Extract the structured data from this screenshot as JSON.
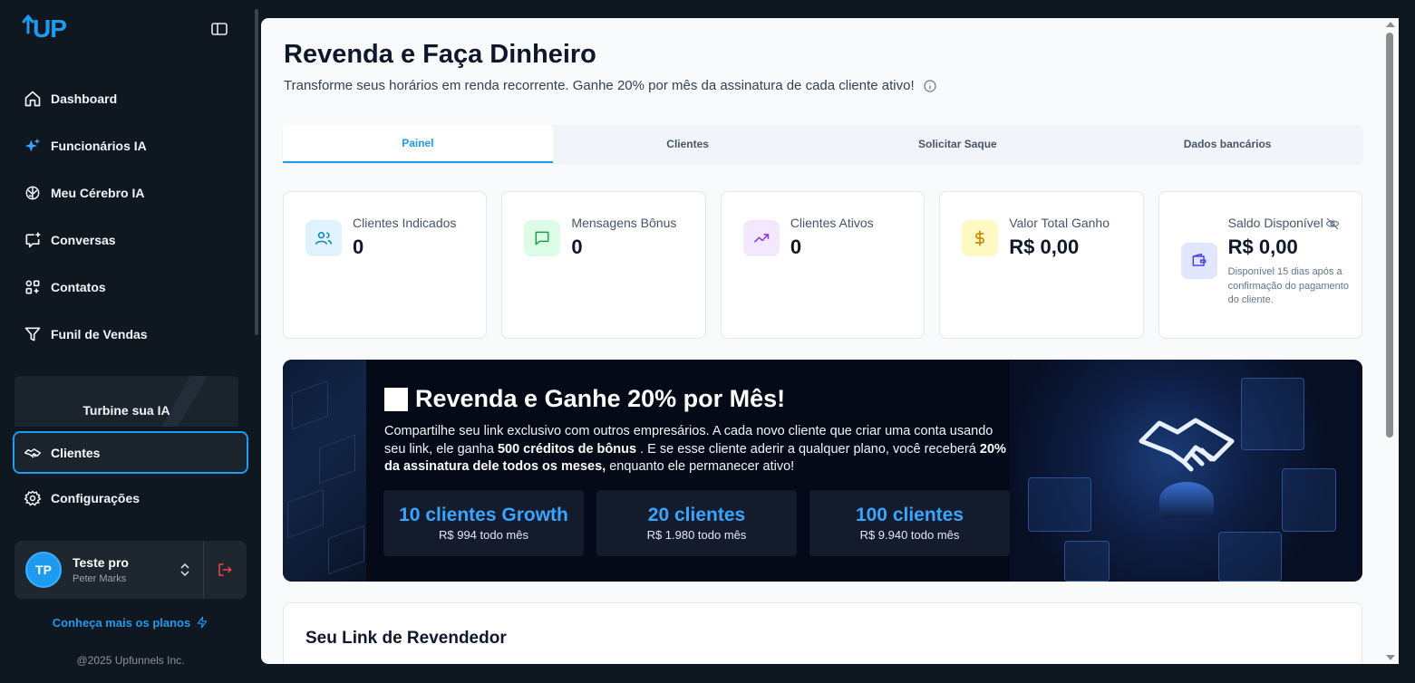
{
  "brand": {
    "logo_text": "UP",
    "accent": "#1d9bf0"
  },
  "sidebar": {
    "items": [
      {
        "label": "Dashboard",
        "icon": "home-icon"
      },
      {
        "label": "Funcionários IA",
        "icon": "sparkles-icon"
      },
      {
        "label": "Meu Cérebro IA",
        "icon": "brain-icon"
      },
      {
        "label": "Conversas",
        "icon": "chat-icon"
      },
      {
        "label": "Contatos",
        "icon": "contacts-icon"
      },
      {
        "label": "Funil de Vendas",
        "icon": "funnel-icon"
      }
    ],
    "promo_title": "Turbine sua IA",
    "active_item": {
      "label": "Clientes",
      "icon": "handshake-icon"
    },
    "config_item": {
      "label": "Configurações",
      "icon": "gear-icon"
    },
    "user": {
      "initials": "TP",
      "name": "Teste pro",
      "subtitle": "Peter Marks"
    },
    "plans_link": "Conheça mais os planos",
    "copyright": "@2025 Upfunnels Inc."
  },
  "page": {
    "title": "Revenda e Faça Dinheiro",
    "subtitle": "Transforme seus horários em renda recorrente. Ganhe 20% por mês da assinatura de cada cliente ativo!"
  },
  "tabs": [
    {
      "label": "Painel",
      "active": true
    },
    {
      "label": "Clientes",
      "active": false
    },
    {
      "label": "Solicitar Saque",
      "active": false
    },
    {
      "label": "Dados bancários",
      "active": false
    }
  ],
  "cards": [
    {
      "label": "Clientes Indicados",
      "value": "0",
      "icon": "users-icon",
      "bg": "#e0f2fe",
      "color": "#0284c7"
    },
    {
      "label": "Mensagens Bônus",
      "value": "0",
      "icon": "message-icon",
      "bg": "#dcfce7",
      "color": "#16a34a"
    },
    {
      "label": "Clientes Ativos",
      "value": "0",
      "icon": "trending-up-icon",
      "bg": "#f3e8ff",
      "color": "#9333ea"
    },
    {
      "label": "Valor Total Ganho",
      "value": "R$ 0,00",
      "icon": "dollar-icon",
      "bg": "#fef9c3",
      "color": "#ca8a04"
    },
    {
      "label": "Saldo Disponível",
      "value": "R$ 0,00",
      "icon": "wallet-icon",
      "bg": "#e0e7ff",
      "color": "#4f46e5",
      "note": "Disponível 15 dias após a confirmação do pagamento do cliente."
    }
  ],
  "hero": {
    "title": "Revenda e Ganhe 20% por Mês!",
    "text_1": "Compartilhe seu link exclusivo com outros empresários. A cada novo cliente que criar uma conta usando seu link, ele ganha ",
    "bold_1": "500 créditos de bônus",
    "text_2": " . E se esse cliente aderir a qualquer plano, você receberá ",
    "bold_2": "20% da assinatura dele todos os meses,",
    "text_3": " enquanto ele permanecer ativo!",
    "stats": [
      {
        "title": "10 clientes Growth",
        "sub": "R$ 994 todo mês"
      },
      {
        "title": "20 clientes",
        "sub": "R$ 1.980 todo mês"
      },
      {
        "title": "100 clientes",
        "sub": "R$ 9.940 todo mês"
      }
    ]
  },
  "link_section": {
    "title": "Seu Link de Revendedor"
  }
}
